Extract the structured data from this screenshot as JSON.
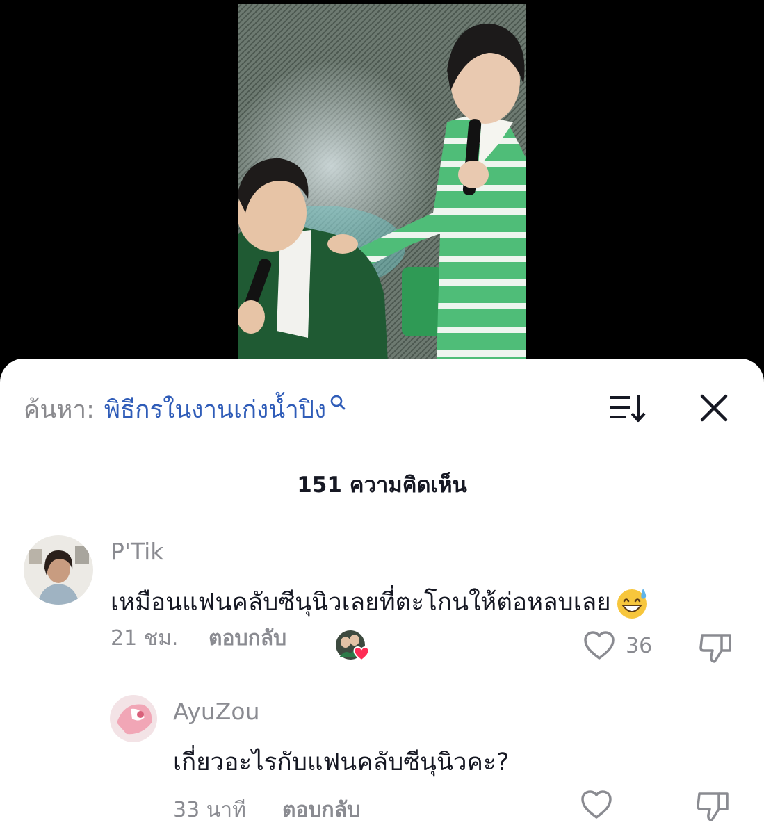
{
  "search": {
    "prefix": "ค้นหา:",
    "query": "พิธีกรในงานเก่งน้ำปิง"
  },
  "comments_header": {
    "count_label": "151 ความคิดเห็น"
  },
  "comments": [
    {
      "username": "P'Tik",
      "text": "เหมือนแฟนคลับซีนุนิวเลยที่ตะโกนให้ต่อหลบเลย",
      "emoji": "grinning-sweat-emoji",
      "time": "21 ชม.",
      "reply_label": "ตอบกลับ",
      "like_count": "36",
      "creator_liked": true
    },
    {
      "username": "AyuZou",
      "text": "เกี่ยวอะไรกับแฟนคลับซีนุนิวคะ?",
      "time": "33 นาที",
      "reply_label": "ตอบกลับ",
      "like_count": "",
      "creator_liked": false
    }
  ],
  "icons": {
    "search": "search-icon",
    "sort": "sort-icon",
    "close": "close-icon",
    "like": "heart-outline-icon",
    "dislike": "thumbs-down-icon"
  },
  "colors": {
    "link_blue": "#2f5cb8",
    "text_primary": "#161823",
    "text_secondary": "#8a8b91",
    "heart_red": "#fe2c55"
  }
}
